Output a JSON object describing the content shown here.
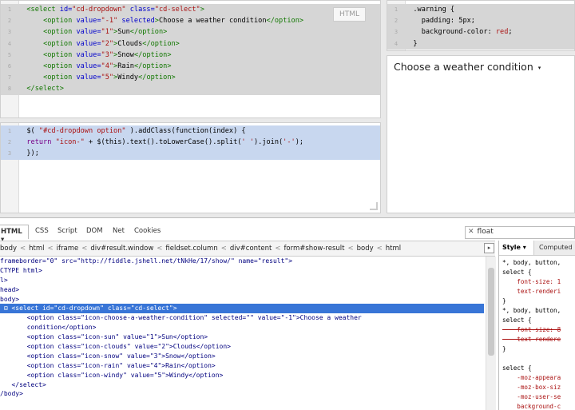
{
  "html_panel": {
    "badge": "HTML",
    "lines": [
      {
        "n": "1",
        "segments": [
          [
            "tag",
            "<select "
          ],
          [
            "attr",
            "id="
          ],
          [
            "str",
            "\"cd-dropdown\""
          ],
          [
            "attr",
            " class="
          ],
          [
            "str",
            "\"cd-select\""
          ],
          [
            "tag",
            ">"
          ]
        ]
      },
      {
        "n": "2",
        "segments": [
          [
            "txt",
            "    "
          ],
          [
            "tag",
            "<option "
          ],
          [
            "attr",
            "value="
          ],
          [
            "str",
            "\"-1\""
          ],
          [
            "attr",
            " selected"
          ],
          [
            "tag",
            ">"
          ],
          [
            "txt",
            "Choose a weather condition"
          ],
          [
            "tag",
            "</option>"
          ]
        ]
      },
      {
        "n": "3",
        "segments": [
          [
            "txt",
            "    "
          ],
          [
            "tag",
            "<option "
          ],
          [
            "attr",
            "value="
          ],
          [
            "str",
            "\"1\""
          ],
          [
            "tag",
            ">"
          ],
          [
            "txt",
            "Sun"
          ],
          [
            "tag",
            "</option>"
          ]
        ]
      },
      {
        "n": "4",
        "segments": [
          [
            "txt",
            "    "
          ],
          [
            "tag",
            "<option "
          ],
          [
            "attr",
            "value="
          ],
          [
            "str",
            "\"2\""
          ],
          [
            "tag",
            ">"
          ],
          [
            "txt",
            "Clouds"
          ],
          [
            "tag",
            "</option>"
          ]
        ]
      },
      {
        "n": "5",
        "segments": [
          [
            "txt",
            "    "
          ],
          [
            "tag",
            "<option "
          ],
          [
            "attr",
            "value="
          ],
          [
            "str",
            "\"3\""
          ],
          [
            "tag",
            ">"
          ],
          [
            "txt",
            "Snow"
          ],
          [
            "tag",
            "</option>"
          ]
        ]
      },
      {
        "n": "6",
        "segments": [
          [
            "txt",
            "    "
          ],
          [
            "tag",
            "<option "
          ],
          [
            "attr",
            "value="
          ],
          [
            "str",
            "\"4\""
          ],
          [
            "tag",
            ">"
          ],
          [
            "txt",
            "Rain"
          ],
          [
            "tag",
            "</option>"
          ]
        ]
      },
      {
        "n": "7",
        "segments": [
          [
            "txt",
            "    "
          ],
          [
            "tag",
            "<option "
          ],
          [
            "attr",
            "value="
          ],
          [
            "str",
            "\"5\""
          ],
          [
            "tag",
            ">"
          ],
          [
            "txt",
            "Windy"
          ],
          [
            "tag",
            "</option>"
          ]
        ]
      },
      {
        "n": "8",
        "segments": [
          [
            "tag",
            "</select>"
          ]
        ]
      }
    ]
  },
  "css_panel": {
    "lines": [
      {
        "n": "1",
        "segments": [
          [
            "txt",
            ".warning {"
          ]
        ]
      },
      {
        "n": "2",
        "segments": [
          [
            "txt",
            "  padding: 5px;"
          ]
        ]
      },
      {
        "n": "3",
        "segments": [
          [
            "txt",
            "  background-color: "
          ],
          [
            "str",
            "red"
          ],
          [
            "txt",
            ";"
          ]
        ]
      },
      {
        "n": "4",
        "segments": [
          [
            "txt",
            "}"
          ]
        ]
      }
    ]
  },
  "js_panel": {
    "lines": [
      {
        "n": "1",
        "segments": [
          [
            "txt",
            "$( "
          ],
          [
            "str",
            "\"#cd-dropdown option\""
          ],
          [
            "txt",
            " ).addClass(function(index) {"
          ]
        ]
      },
      {
        "n": "2",
        "segments": [
          [
            "kw",
            "return"
          ],
          [
            "txt",
            " "
          ],
          [
            "str",
            "\"icon-\""
          ],
          [
            "txt",
            " + $(this).text().toLowerCase().split("
          ],
          [
            "str",
            "' '"
          ],
          [
            "txt",
            ").join("
          ],
          [
            "str",
            "'-'"
          ],
          [
            "txt",
            ");"
          ]
        ]
      },
      {
        "n": "3",
        "segments": [
          [
            "txt",
            "});"
          ]
        ]
      }
    ]
  },
  "result": {
    "select_value": "Choose a weather condition",
    "arrow": "▾"
  },
  "firebug": {
    "tabs": {
      "html": "HTML",
      "html_arrow": "▾",
      "css": "CSS",
      "script": "Script",
      "dom": "DOM",
      "net": "Net",
      "cookies": "Cookies"
    },
    "search": {
      "icon": "✕",
      "value": "float"
    },
    "breadcrumb": [
      "body",
      "html",
      "iframe",
      "div#result.window",
      "fieldset.column",
      "div#content",
      "form#show-result",
      "body",
      "html"
    ],
    "html_lines": [
      {
        "text": "frameborder=\"0\" src=\"http://fiddle.jshell.net/tNkHe/17/show/\" name=\"result\">"
      },
      {
        "text": "CTYPE html>"
      },
      {
        "text": "l>"
      },
      {
        "text": "head>"
      },
      {
        "text": "body>"
      },
      {
        "text": " ⊟ <select id=\"cd-dropdown\" class=\"cd-select\">",
        "selected": true
      },
      {
        "text": "       <option class=\"icon-choose-a-weather-condition\" selected=\"\" value=\"-1\">Choose a weather"
      },
      {
        "text": "       condition</option>"
      },
      {
        "text": "       <option class=\"icon-sun\" value=\"1\">Sun</option>"
      },
      {
        "text": "       <option class=\"icon-clouds\" value=\"2\">Clouds</option>"
      },
      {
        "text": "       <option class=\"icon-snow\" value=\"3\">Snow</option>"
      },
      {
        "text": "       <option class=\"icon-rain\" value=\"4\">Rain</option>"
      },
      {
        "text": "       <option class=\"icon-windy\" value=\"5\">Windy</option>"
      },
      {
        "text": "   </select>"
      },
      {
        "text": "/body>"
      }
    ],
    "side": {
      "tab_style": "Style",
      "tab_style_arrow": "▾",
      "tab_computed": "Computed",
      "lines": [
        {
          "t": "*, body, button,",
          "k": "sel"
        },
        {
          "t": "select {",
          "k": "sel"
        },
        {
          "t": "    font-size: 1",
          "k": "prop"
        },
        {
          "t": "    text-renderi",
          "k": "prop"
        },
        {
          "t": "}",
          "k": "sel"
        },
        {
          "t": "*, body, button,",
          "k": "sel"
        },
        {
          "t": "select {",
          "k": "sel"
        },
        {
          "t": "    font-size: 8",
          "k": "strike"
        },
        {
          "t": "    text-rendere",
          "k": "strike"
        },
        {
          "t": "}",
          "k": "sel"
        },
        {
          "t": "",
          "k": "sel"
        },
        {
          "t": "select {",
          "k": "sel"
        },
        {
          "t": "    -moz-appeara",
          "k": "prop"
        },
        {
          "t": "    -moz-box-siz",
          "k": "prop"
        },
        {
          "t": "    -moz-user-se",
          "k": "prop"
        },
        {
          "t": "    background-c",
          "k": "prop"
        }
      ]
    }
  }
}
